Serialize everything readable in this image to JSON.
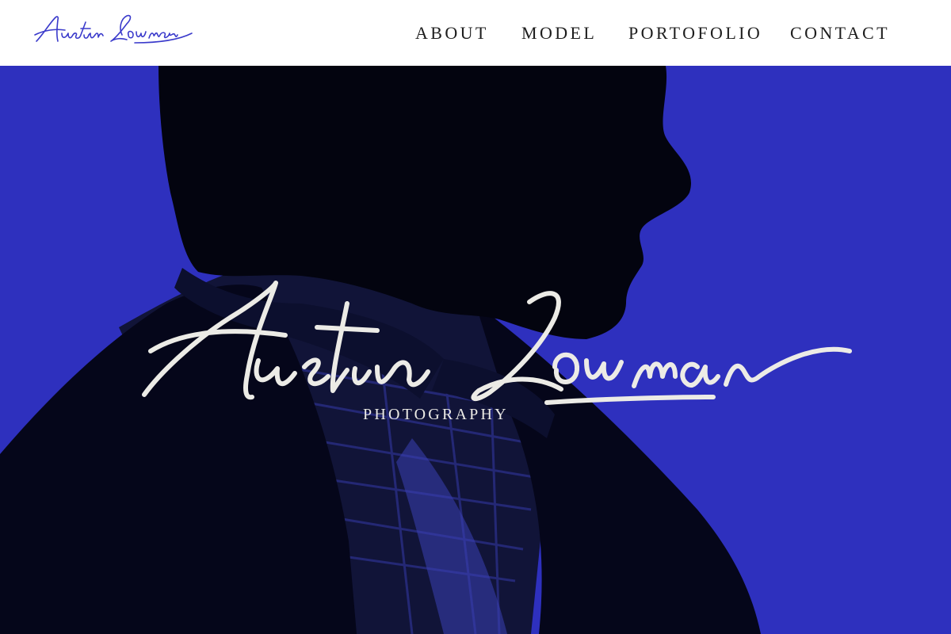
{
  "brand": {
    "name": "Austin Lowman",
    "logo_color": "#3a3acb"
  },
  "nav": [
    {
      "label": "ABOUT"
    },
    {
      "label": "MODEL"
    },
    {
      "label": "PORTOFOLIO"
    },
    {
      "label": "CONTACT"
    }
  ],
  "hero": {
    "background_color": "#2e30be",
    "signature": "Austin Lowman",
    "tagline": "PHOTOGRAPHY",
    "portrait_icon": "man-silhouette-portrait"
  }
}
